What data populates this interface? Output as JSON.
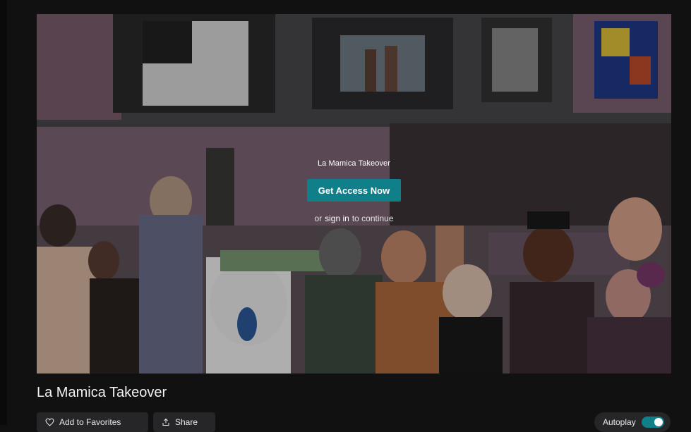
{
  "player": {
    "overlay_title": "La Mamica Takeover",
    "cta_label": "Get Access Now",
    "signin_prefix": "or",
    "signin_link": "sign in",
    "signin_suffix": "to continue"
  },
  "video": {
    "title": "La Mamica Takeover"
  },
  "actions": {
    "favorites_label": "Add to Favorites",
    "share_label": "Share",
    "autoplay_label": "Autoplay",
    "autoplay_on": true
  },
  "colors": {
    "accent": "#0f7f8a",
    "page_bg": "#111111",
    "button_bg": "#262628"
  },
  "icons": {
    "favorites": "heart-outline-icon",
    "share": "share-upload-icon"
  }
}
